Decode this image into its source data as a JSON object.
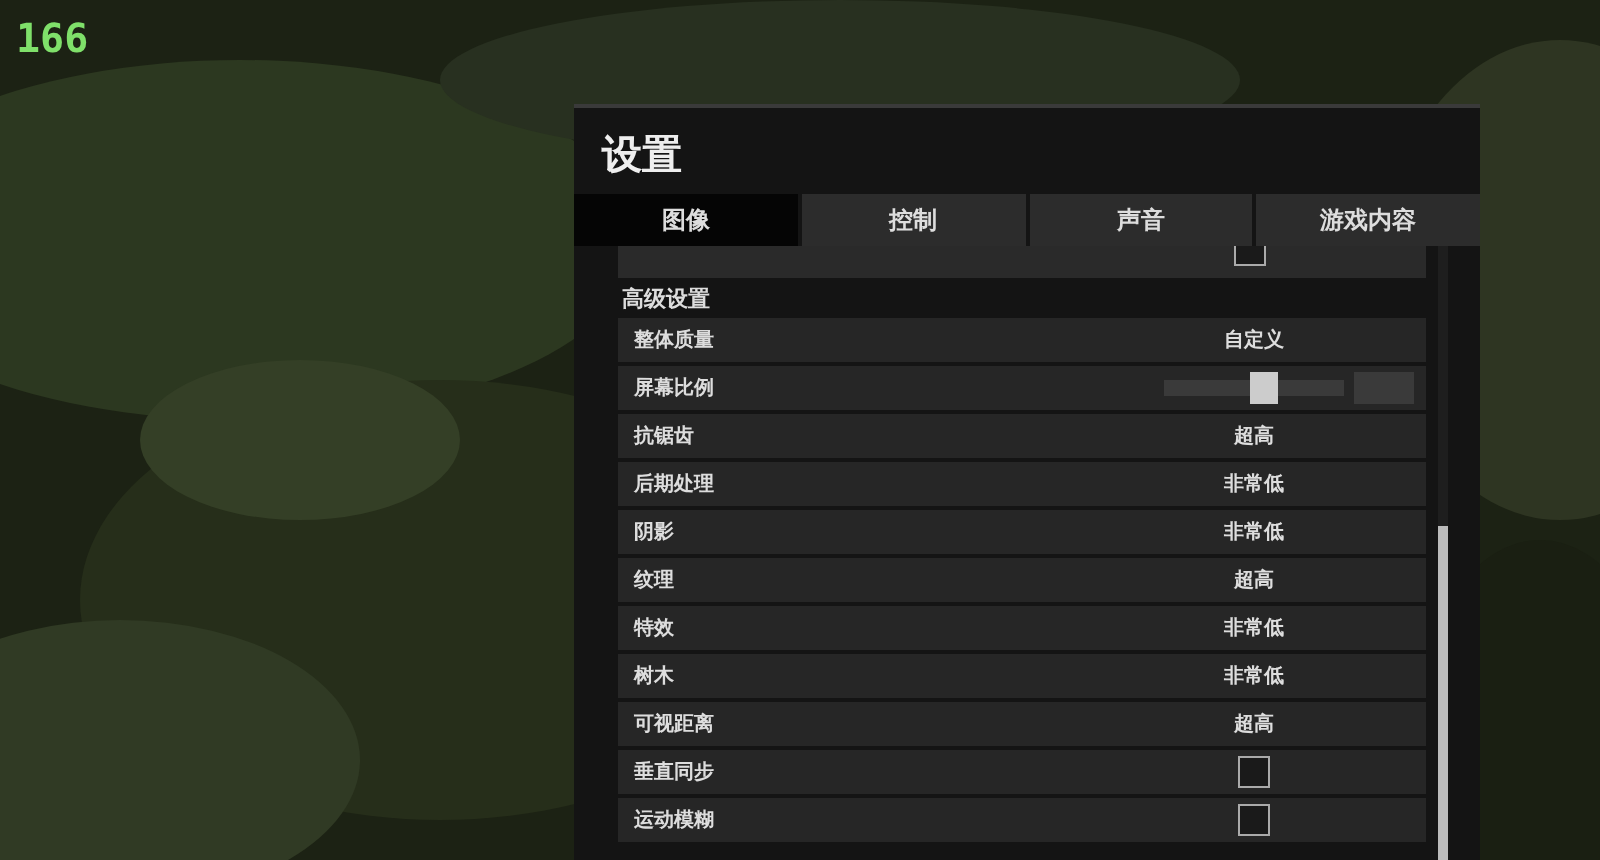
{
  "fps_counter": "166",
  "window": {
    "title": "设置"
  },
  "tabs": [
    {
      "label": "图像",
      "selected": true
    },
    {
      "label": "控制",
      "selected": false
    },
    {
      "label": "声音",
      "selected": false
    },
    {
      "label": "游戏内容",
      "selected": false
    }
  ],
  "top_row": {
    "kind": "checkbox",
    "checked": false
  },
  "section": "高级设置",
  "rows": [
    {
      "kind": "choice",
      "label": "整体质量",
      "value": "自定义"
    },
    {
      "kind": "slider",
      "label": "屏幕比例",
      "level": 0.55
    },
    {
      "kind": "choice",
      "label": "抗锯齿",
      "value": "超高"
    },
    {
      "kind": "choice",
      "label": "后期处理",
      "value": "非常低"
    },
    {
      "kind": "choice",
      "label": "阴影",
      "value": "非常低"
    },
    {
      "kind": "choice",
      "label": "纹理",
      "value": "超高"
    },
    {
      "kind": "choice",
      "label": "特效",
      "value": "非常低"
    },
    {
      "kind": "choice",
      "label": "树木",
      "value": "非常低"
    },
    {
      "kind": "choice",
      "label": "可视距离",
      "value": "超高"
    },
    {
      "kind": "checkbox",
      "label": "垂直同步",
      "checked": false
    },
    {
      "kind": "checkbox",
      "label": "运动模糊",
      "checked": false
    }
  ]
}
